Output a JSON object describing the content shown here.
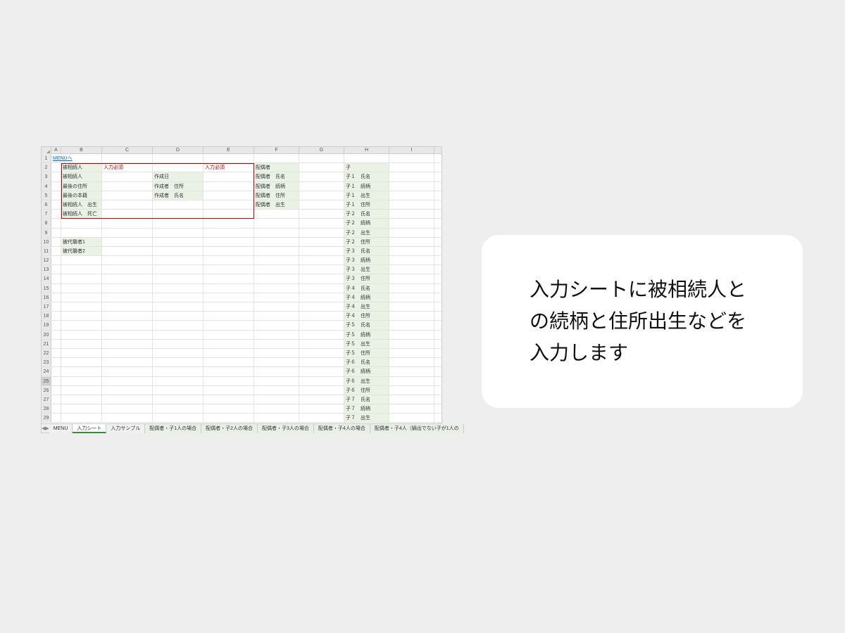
{
  "columns": [
    "A",
    "B",
    "C",
    "D",
    "E",
    "F",
    "G",
    "H",
    "I"
  ],
  "column_widths": [
    "wA",
    "wB",
    "wC",
    "wD",
    "wE",
    "wF",
    "wG",
    "wH",
    "wI"
  ],
  "link_text": "MENUへ",
  "required_text": "入力必須",
  "rows": [
    {
      "n": 1,
      "cells": {
        "A": {
          "t": "MENUへ",
          "link": true,
          "span": 2
        }
      }
    },
    {
      "n": 2,
      "cells": {
        "B": {
          "t": "被相続人",
          "fill": true
        },
        "C": {
          "t": "入力必須",
          "red": true
        },
        "E": {
          "t": "入力必須",
          "red": true
        },
        "F": {
          "t": "配偶者",
          "fill": true
        },
        "H": {
          "t": "子",
          "fill": true
        }
      }
    },
    {
      "n": 3,
      "cells": {
        "B": {
          "t": "被相続人",
          "fill": true
        },
        "D": {
          "t": "作成日",
          "fill": true
        },
        "F": {
          "t": "配偶者　氏名",
          "fill": true
        },
        "H": {
          "t": "子１　氏名",
          "fill": true
        }
      }
    },
    {
      "n": 4,
      "cells": {
        "B": {
          "t": "最後の住所",
          "fill": true
        },
        "D": {
          "t": "作成者　住所",
          "fill": true
        },
        "F": {
          "t": "配偶者　続柄",
          "fill": true
        },
        "H": {
          "t": "子１　続柄",
          "fill": true
        }
      }
    },
    {
      "n": 5,
      "cells": {
        "B": {
          "t": "最後の本籍",
          "fill": true
        },
        "D": {
          "t": "作成者　氏名",
          "fill": true
        },
        "F": {
          "t": "配偶者　住所",
          "fill": true
        },
        "H": {
          "t": "子１　出生",
          "fill": true
        }
      }
    },
    {
      "n": 6,
      "cells": {
        "B": {
          "t": "被相続人　出生",
          "fill": true
        },
        "F": {
          "t": "配偶者　出生",
          "fill": true
        },
        "H": {
          "t": "子１　住所",
          "fill": true
        }
      }
    },
    {
      "n": 7,
      "cells": {
        "B": {
          "t": "被相続人　死亡",
          "fill": true
        },
        "H": {
          "t": "子２　氏名",
          "fill": true
        }
      }
    },
    {
      "n": 8,
      "cells": {
        "H": {
          "t": "子２　続柄",
          "fill": true
        }
      }
    },
    {
      "n": 9,
      "cells": {
        "H": {
          "t": "子２　出生",
          "fill": true
        }
      }
    },
    {
      "n": 10,
      "cells": {
        "B": {
          "t": "被代襲者1",
          "fill": true
        },
        "H": {
          "t": "子２　住所",
          "fill": true
        }
      }
    },
    {
      "n": 11,
      "cells": {
        "B": {
          "t": "被代襲者2",
          "fill": true
        },
        "H": {
          "t": "子３　氏名",
          "fill": true
        }
      }
    },
    {
      "n": 12,
      "cells": {
        "H": {
          "t": "子３　続柄",
          "fill": true
        }
      }
    },
    {
      "n": 13,
      "cells": {
        "H": {
          "t": "子３　出生",
          "fill": true
        }
      }
    },
    {
      "n": 14,
      "cells": {
        "H": {
          "t": "子３　住所",
          "fill": true
        }
      }
    },
    {
      "n": 15,
      "cells": {
        "H": {
          "t": "子４　氏名",
          "fill": true
        }
      }
    },
    {
      "n": 16,
      "cells": {
        "H": {
          "t": "子４　続柄",
          "fill": true
        }
      }
    },
    {
      "n": 17,
      "cells": {
        "H": {
          "t": "子４　出生",
          "fill": true
        }
      }
    },
    {
      "n": 18,
      "cells": {
        "H": {
          "t": "子４　住所",
          "fill": true
        }
      }
    },
    {
      "n": 19,
      "cells": {
        "H": {
          "t": "子５　氏名",
          "fill": true
        }
      }
    },
    {
      "n": 20,
      "cells": {
        "H": {
          "t": "子５　続柄",
          "fill": true
        }
      }
    },
    {
      "n": 21,
      "cells": {
        "H": {
          "t": "子５　出生",
          "fill": true
        }
      }
    },
    {
      "n": 22,
      "cells": {
        "H": {
          "t": "子５　住所",
          "fill": true
        }
      }
    },
    {
      "n": 23,
      "cells": {
        "H": {
          "t": "子６　氏名",
          "fill": true
        }
      }
    },
    {
      "n": 24,
      "cells": {
        "H": {
          "t": "子６　続柄",
          "fill": true
        }
      }
    },
    {
      "n": 25,
      "cells": {
        "H": {
          "t": "子６　出生",
          "fill": true
        }
      },
      "active": true
    },
    {
      "n": 26,
      "cells": {
        "H": {
          "t": "子６　住所",
          "fill": true
        }
      }
    },
    {
      "n": 27,
      "cells": {
        "H": {
          "t": "子７　氏名",
          "fill": true
        }
      }
    },
    {
      "n": 28,
      "cells": {
        "H": {
          "t": "子７　続柄",
          "fill": true
        }
      }
    },
    {
      "n": 29,
      "cells": {
        "H": {
          "t": "子７　出生",
          "fill": true
        }
      }
    }
  ],
  "tabs": [
    {
      "label": "MENU",
      "plain": true
    },
    {
      "label": "入力シート",
      "active": true,
      "plain": true
    },
    {
      "label": "入力サンプル",
      "plain": true
    },
    {
      "label": "配偶者・子1人の場合"
    },
    {
      "label": "配偶者・子2人の場合"
    },
    {
      "label": "配偶者・子3人の場合"
    },
    {
      "label": "配偶者・子4人の場合"
    },
    {
      "label": "配偶者・子4人（嫡出でない子が1人の"
    }
  ],
  "nav": {
    "prev": "◀",
    "next": "▶"
  },
  "callout_text": "入力シートに被相続人との続柄と住所出生などを入力します",
  "red_box": {
    "top_row": 2,
    "bottom_row": 7,
    "left_col": "B",
    "right_col": "E"
  }
}
